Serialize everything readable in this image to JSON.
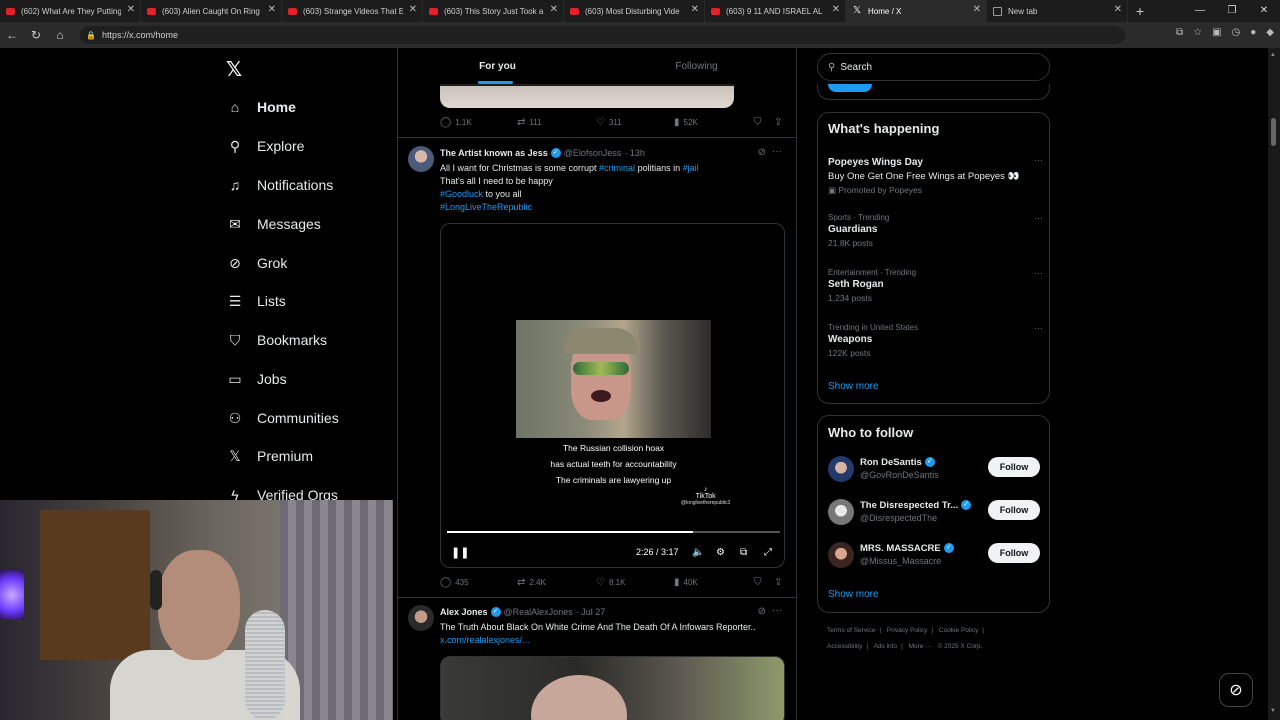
{
  "browser": {
    "tabs": [
      {
        "label": "(602) What Are They Putting",
        "icon": "youtube-icon"
      },
      {
        "label": "(603) Alien Caught On Ring",
        "icon": "youtube-icon"
      },
      {
        "label": "(603) Strange Videos That E",
        "icon": "youtube-icon"
      },
      {
        "label": "(603) This Story Just Took a",
        "icon": "youtube-icon"
      },
      {
        "label": "(603) Most Disturbing Vide",
        "icon": "youtube-icon"
      },
      {
        "label": "(603) 9 11 AND ISRAEL AL",
        "icon": "youtube-icon"
      },
      {
        "label": "Home / X",
        "icon": "x-icon",
        "active": true
      },
      {
        "label": "New tab",
        "icon": "newtab-icon"
      }
    ],
    "url": "https://x.com/home"
  },
  "nav": {
    "items": [
      {
        "label": "Home",
        "icon": "home-icon"
      },
      {
        "label": "Explore",
        "icon": "search-icon"
      },
      {
        "label": "Notifications",
        "icon": "bell-icon"
      },
      {
        "label": "Messages",
        "icon": "mail-icon"
      },
      {
        "label": "Grok",
        "icon": "grok-icon"
      },
      {
        "label": "Lists",
        "icon": "list-icon"
      },
      {
        "label": "Bookmarks",
        "icon": "bookmark-icon"
      },
      {
        "label": "Jobs",
        "icon": "briefcase-icon"
      },
      {
        "label": "Communities",
        "icon": "people-icon"
      },
      {
        "label": "Premium",
        "icon": "x-icon"
      },
      {
        "label": "Verified Orgs",
        "icon": "lightning-icon"
      }
    ]
  },
  "feed": {
    "tabs": {
      "for_you": "For you",
      "following": "Following"
    },
    "top_actions": {
      "replies": "1.1K",
      "reposts": "111",
      "likes": "311",
      "views": "52K"
    },
    "post1": {
      "name": "The Artist known as Jess",
      "handle": "@ElofsonJess",
      "time": "· 13h",
      "line1_a": "All I want for Christmas is some corrupt ",
      "line1_tag1": "#criminal",
      "line1_b": " politians in ",
      "line1_tag2": "#jail",
      "line2": "That's all I need to be happy",
      "line3_tag": "#Goodluck",
      "line3_b": " to you all",
      "line4_tag": "#LongLiveTheRepublic",
      "video": {
        "caption1": "The Russian collision hoax",
        "caption2": "has actual teeth for accountability",
        "caption3": "The criminals are lawyering up",
        "tiktok": "TikTok",
        "tiktok_handle": "@longlivetherepublic3",
        "time": "2:26 / 3:17",
        "progress": 0.74
      },
      "actions": {
        "replies": "435",
        "reposts": "2.4K",
        "likes": "8.1K",
        "views": "40K"
      }
    },
    "post2": {
      "name": "Alex Jones",
      "handle": "@RealAlexJones",
      "time": "· Jul 27",
      "text": "The Truth About Black On White Crime And The Death Of A Infowars Reporter..",
      "link": "x.com/realalexjones/..."
    }
  },
  "right": {
    "search_placeholder": "Search",
    "happening_title": "What's happening",
    "trends": [
      {
        "category": "",
        "title": "Popeyes Wings Day",
        "desc": "Buy One Get One Free Wings at Popeyes 👀",
        "sub": "Promoted by Popeyes"
      },
      {
        "category": "Sports · Trending",
        "title": "Guardians",
        "sub": "21.8K posts"
      },
      {
        "category": "Entertainment · Trending",
        "title": "Seth Rogan",
        "sub": "1,234 posts"
      },
      {
        "category": "Trending in United States",
        "title": "Weapons",
        "sub": "122K posts"
      }
    ],
    "show_more": "Show more",
    "follow_title": "Who to follow",
    "follow": [
      {
        "name": "Ron DeSantis",
        "handle": "@GovRonDeSantis",
        "button": "Follow"
      },
      {
        "name": "The Disrespected Tr...",
        "handle": "@DisrespectedThe",
        "button": "Follow"
      },
      {
        "name": "MRS. MASSACRE",
        "handle": "@Missus_Massacre",
        "button": "Follow"
      }
    ],
    "show_more2": "Show more",
    "footer": {
      "terms": "Terms of Service",
      "privacy": "Privacy Policy",
      "cookie": "Cookie Policy",
      "accessibility": "Accessibility",
      "ads": "Ads info",
      "more": "More ···",
      "copyright": "© 2025 X Corp."
    }
  },
  "colors": {
    "accent": "#1d9bf0",
    "bg": "#000000",
    "border": "#2f3336",
    "muted": "#71767b"
  }
}
